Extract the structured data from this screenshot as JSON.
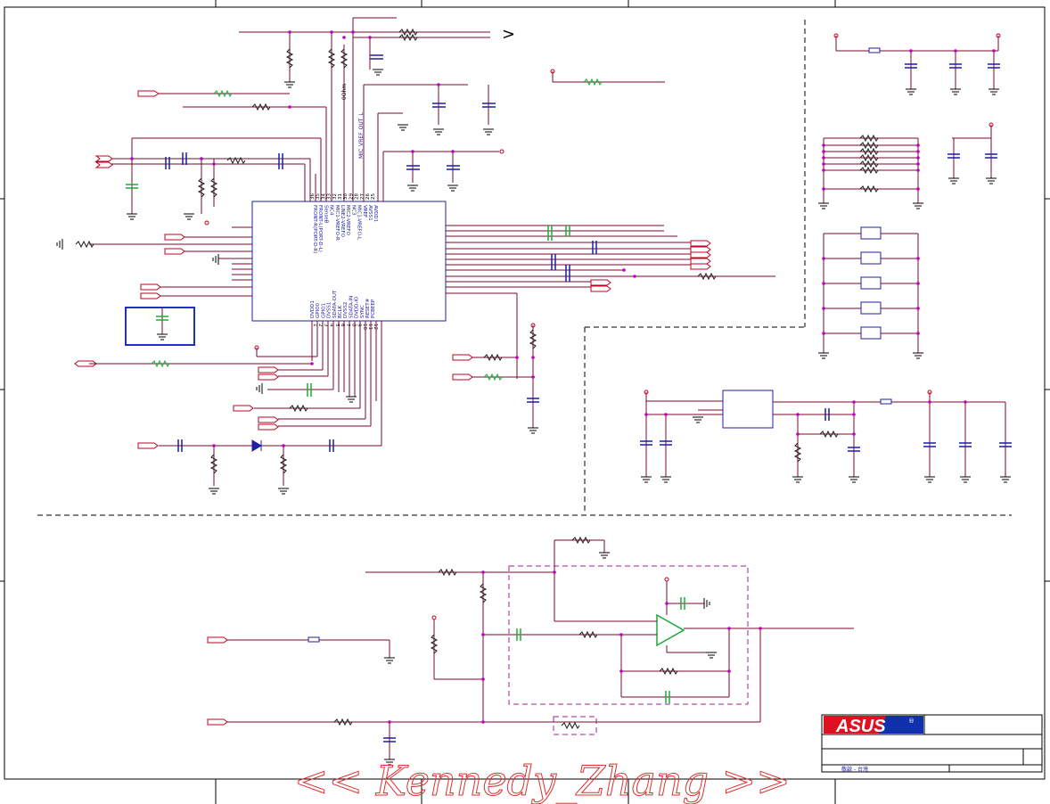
{
  "codec_chip": {
    "left_pins": [
      {
        "num": "36",
        "label": "FRONT-R(PORT-D-R)"
      },
      {
        "num": "35",
        "label": "FRONT-L(PORT-D-L)"
      },
      {
        "num": "34",
        "label": "SenseB"
      },
      {
        "num": "33",
        "label": "NC4"
      },
      {
        "num": "32",
        "label": "MIC1-VREFO-R"
      },
      {
        "num": "31",
        "label": "LINE2-VREFO"
      },
      {
        "num": "30",
        "label": "MIC2-VREFO"
      },
      {
        "num": "29",
        "label": "NC3"
      },
      {
        "num": "28",
        "label": "MIC1-VREFO-L"
      },
      {
        "num": "27",
        "label": "VREF"
      },
      {
        "num": "26",
        "label": "AVSS1"
      },
      {
        "num": "25",
        "label": "AVDD1"
      }
    ],
    "bottom_pins": [
      {
        "num": "1",
        "label": "DVDD1"
      },
      {
        "num": "2",
        "label": "GPIO0"
      },
      {
        "num": "3",
        "label": "GPIO1"
      },
      {
        "num": "4",
        "label": "DVSS1"
      },
      {
        "num": "5",
        "label": "SDATA-OUT"
      },
      {
        "num": "6",
        "label": "BCLK"
      },
      {
        "num": "7",
        "label": "DVSS2"
      },
      {
        "num": "8",
        "label": "SDATA-IN"
      },
      {
        "num": "9",
        "label": "DVDD-IO"
      },
      {
        "num": "10",
        "label": "SYNC"
      },
      {
        "num": "11",
        "label": "RESET#"
      },
      {
        "num": "12",
        "label": "PCBEEP"
      }
    ]
  },
  "labels": {
    "zero_ohm": "0Ohm",
    "mic_vref_net": "MIC_VREF_OUT_L",
    "arrow_glyph": ">"
  },
  "title_block": {
    "logo": "ASUS",
    "registered": "®",
    "footer_note": "敬啟 - 台灣"
  },
  "watermark": "<< Kennedy_Zhang >>",
  "colors": {
    "wire": "#7a0a2a",
    "junction": "#c000c0",
    "chip_outline": "#2020a0",
    "highlight_box": "#2030c0",
    "logo_red": "#e01020",
    "logo_blue": "#1030b0",
    "watermark": "#e03030"
  }
}
